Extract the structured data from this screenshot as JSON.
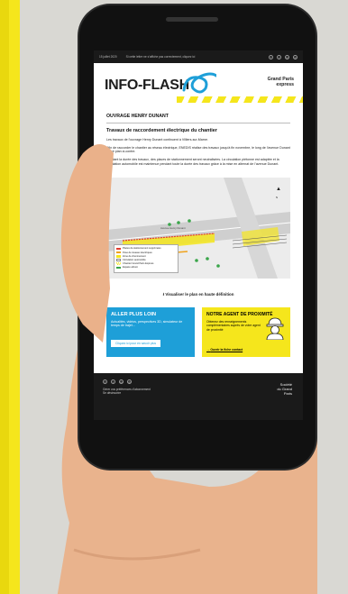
{
  "topbar": {
    "date": "15 juillet 2020",
    "email_link": "Si cette lettre ne s’affiche pas correctement, cliquez ici",
    "social_icons": [
      "facebook-icon",
      "twitter-icon",
      "linkedin-icon",
      "instagram-icon"
    ]
  },
  "header": {
    "title": "INFO-FLASH",
    "logo_line1": "Grand Paris",
    "logo_line2": "express"
  },
  "article": {
    "section_title": "OUVRAGE HENRY DUNANT",
    "heading": "Travaux de raccordement électrique du chantier",
    "para1": "Les travaux de l’ouvrage Henry Dunant continuent à Villiers-sur-Marne.",
    "para2": "Afin de raccorder le chantier au réseau électrique, ENEDIS réalise des travaux jusqu’à fin novembre, le long de l’avenue Dunant – voir plan ci-contre.",
    "para3": "Pendant la durée des travaux, des places de stationnement seront neutralisées. La circulation piétonne est adaptée et la circulation automobile est maintenue pendant toute la durée des travaux grâce à la mise en alternat de l’avenue Dunant."
  },
  "map": {
    "street_label": "Avenue Henry Dunant",
    "north": "N",
    "legend": [
      {
        "label": "Places de stationnement supprimées",
        "color": "#e23b2e"
      },
      {
        "label": "Pose de réseaux électriques",
        "color": "#f0a21b"
      },
      {
        "label": "Zone de cheminement",
        "color": "#f5e61c"
      },
      {
        "label": "Circulation automobile",
        "color": "#ffffff"
      },
      {
        "label": "Chantier Grand Paris Express",
        "color": "#f5e61c"
      },
      {
        "label": "Espace arboré",
        "color": "#3aa54a"
      }
    ]
  },
  "plan_link": "Visualiser le plan en haute définition",
  "box_left": {
    "title": "ALLER PLUS LOIN",
    "body": "Actualités, vidéos, perspectives 3D, simulateur de temps de trajet...",
    "button": "Cliquez ici pour en savoir plus"
  },
  "box_right": {
    "title": "NOTRE AGENT DE PROXIMITÉ",
    "body": "Obtenez des renseignements complémentaires auprès de votre agent de proximité",
    "link": "Ouvrir la fiche contact"
  },
  "footer": {
    "line1": "Gérer vos préférences d’abonnement",
    "line2": "Se désinscrire",
    "logo_line1": "Société",
    "logo_line2": "du Grand",
    "logo_line3": "Paris"
  },
  "colors": {
    "accent_yellow": "#f5e61c",
    "accent_blue": "#1e9fd8",
    "dark": "#1a1a1a"
  }
}
